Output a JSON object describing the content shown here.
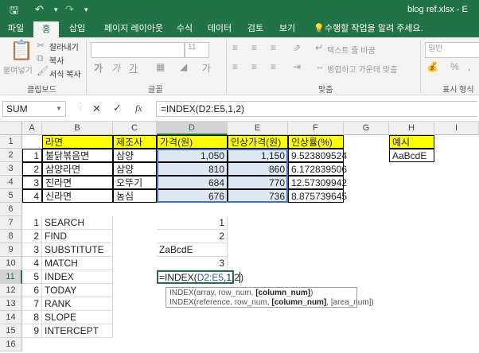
{
  "titlebar": {
    "title": "blog ref.xlsx - E"
  },
  "tabs": [
    "파일",
    "홈",
    "삽입",
    "페이지 레이아웃",
    "수식",
    "데이터",
    "검토",
    "보기",
    "수행할 작업을 알려 주세요."
  ],
  "ribbon": {
    "cut": "잘라내기",
    "copy": "복사",
    "paste": "붙여넣기",
    "format_painter": "서식 복사",
    "clipboard_group": "클립보드",
    "font_group": "글꼴",
    "font_size": "11",
    "wrap_text": "텍스트 줄 바꿈",
    "merge_center": "병합하고 가운데 맞춤",
    "align_group": "맞춤",
    "number_format": "일반",
    "percent": "%",
    "comma": ",",
    "number_group": "표시 형식"
  },
  "formula_bar": {
    "name_box": "SUM",
    "cancel": "✕",
    "enter": "✓",
    "fx": "fx",
    "formula": "=INDEX(D2:E5,1,2)"
  },
  "columns": [
    "A",
    "B",
    "C",
    "D",
    "E",
    "F",
    "G",
    "H",
    "I"
  ],
  "rows": [
    "1",
    "2",
    "3",
    "4",
    "5",
    "6",
    "7",
    "8",
    "9",
    "10",
    "11",
    "12",
    "13",
    "14",
    "15",
    "16"
  ],
  "cells": {
    "B1": "라면",
    "C1": "제조사",
    "D1": "가격(원)",
    "E1": "인상가격(원)",
    "F1": "인상률(%)",
    "H1": "예시",
    "A2": "1",
    "B2": "불닭볶음면",
    "C2": "삼양",
    "D2": "1,050",
    "E2": "1,150",
    "F2": "9.523809524",
    "H2": "AaBcdE",
    "A3": "2",
    "B3": "삼양라면",
    "C3": "삼양",
    "D3": "810",
    "E3": "860",
    "F3": "6.172839506",
    "A4": "3",
    "B4": "진라면",
    "C4": "오뚜기",
    "D4": "684",
    "E4": "770",
    "F4": "12.57309942",
    "A5": "4",
    "B5": "신라면",
    "C5": "농심",
    "D5": "676",
    "E5": "736",
    "F5": "8.875739645",
    "A7": "1",
    "B7": "SEARCH",
    "D7": "1",
    "A8": "2",
    "B8": "FIND",
    "D8": "2",
    "A9": "3",
    "B9": "SUBSTITUTE",
    "D9": "ZaBcdE",
    "A10": "4",
    "B10": "MATCH",
    "D10": "3",
    "A11": "5",
    "B11": "INDEX",
    "A12": "6",
    "B12": "TODAY",
    "A13": "7",
    "B13": "RANK",
    "A14": "8",
    "B14": "SLOPE",
    "A15": "9",
    "B15": "INTERCEPT"
  },
  "edit_cell": {
    "prefix": "=INDEX(",
    "ref": "D2:E5",
    "rest": ",1,2",
    "close": ")"
  },
  "tooltip": {
    "line1_a": "INDEX(array, row_num, ",
    "line1_b": "[column_num]",
    "line1_c": ")",
    "line2_a": "INDEX(reference, row_num, ",
    "line2_b": "[column_num]",
    "line2_c": ", [area_num])"
  },
  "colors": {
    "excel_green": "#217346",
    "yellow": "#ffff00",
    "ref_blue": "#1f5fbf"
  }
}
